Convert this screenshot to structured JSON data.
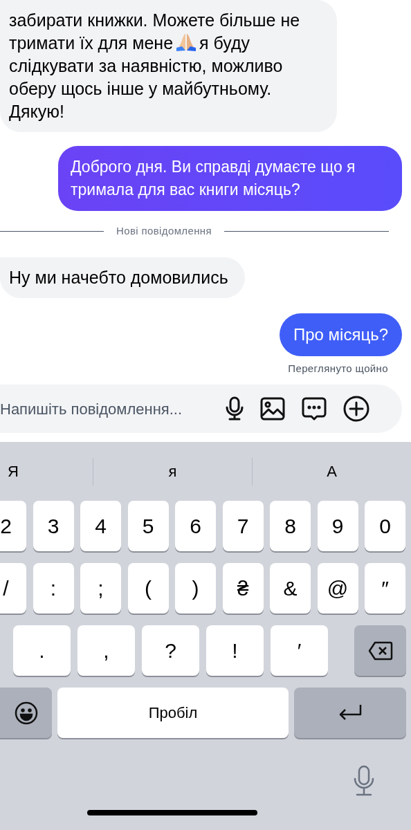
{
  "messages": [
    {
      "kind": "incoming",
      "text": "забирати книжки. Можете більше не тримати їх для мене",
      "text_after": "я буду слідкувати за наявністю, можливо оберу щось інше у майбутньому. Дякую!"
    },
    {
      "kind": "outgoing",
      "text": "Доброго дня. Ви справді думаєте що я тримала для вас книги місяць?"
    },
    {
      "kind": "divider",
      "text": "Нові повідомлення"
    },
    {
      "kind": "incoming",
      "text": "Ну ми начебто домовились"
    },
    {
      "kind": "outgoing_short",
      "text": "Про місяць?"
    },
    {
      "kind": "status",
      "text": "Переглянуто щойно"
    }
  ],
  "composer": {
    "placeholder": "Напишіть повідомлення..."
  },
  "keyboard": {
    "suggestions": [
      "Я",
      "я",
      "А"
    ],
    "row_1": [
      "2",
      "3",
      "4",
      "5",
      "6",
      "7",
      "8",
      "9",
      "0"
    ],
    "row_2": [
      "/",
      ":",
      ";",
      "(",
      ")",
      "₴",
      "&",
      "@",
      "″"
    ],
    "row_3": [
      ".",
      ",",
      "?",
      "!",
      "′"
    ],
    "space": "Пробіл"
  }
}
